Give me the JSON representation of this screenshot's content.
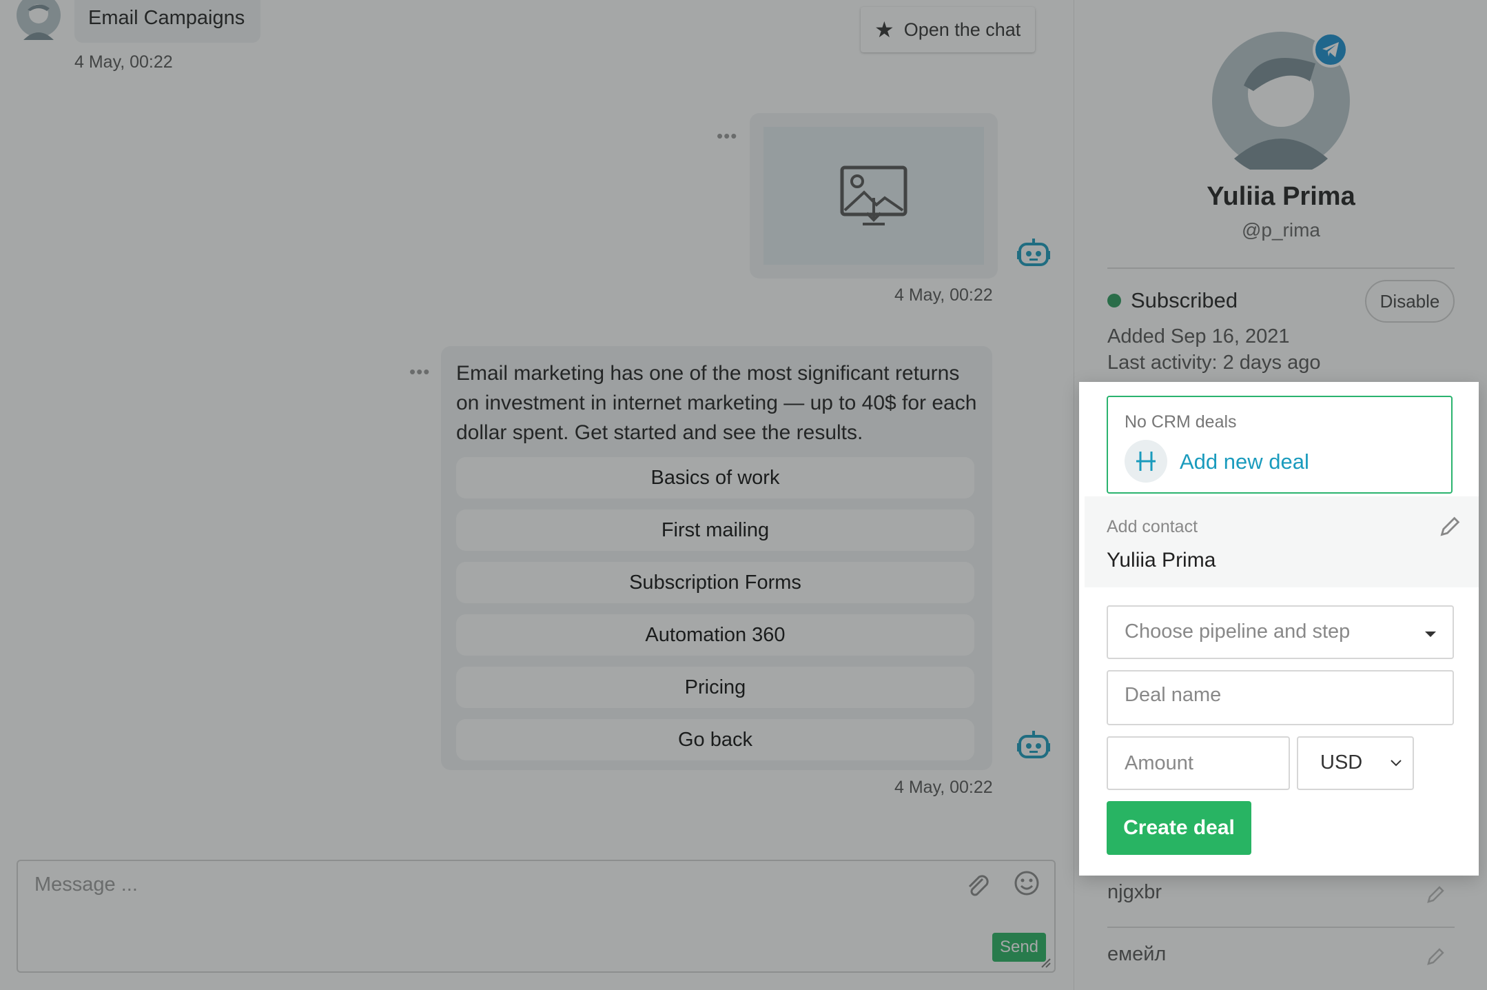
{
  "chat": {
    "campaign_name": "Email Campaigns",
    "open_chat_label": "Open the chat",
    "messages": [
      {
        "timestamp_top": "4 May, 00:22"
      },
      {
        "timestamp": "4 May, 00:22"
      },
      {
        "text": "Email marketing has one of the most significant returns on investment in internet marketing — up to 40$ for each dollar spent. Get started and see the results.",
        "buttons": [
          "Basics of work",
          "First mailing",
          "Subscription Forms",
          "Automation 360",
          "Pricing",
          "Go back"
        ],
        "timestamp": "4 May, 00:22"
      }
    ],
    "composer": {
      "placeholder": "Message ...",
      "send_label": "Send"
    }
  },
  "profile": {
    "name": "Yuliia Prima",
    "handle": "@p_rima",
    "status": "Subscribed",
    "disable_label": "Disable",
    "added": "Added Sep 16, 2021",
    "last_activity": "Last activity: 2 days ago",
    "fields": [
      "njgxbr",
      "емейл"
    ]
  },
  "deal_form": {
    "no_deals": "No CRM deals",
    "add_deal_label": "Add new deal",
    "contact_label": "Add contact",
    "contact_name": "Yuliia Prima",
    "pipeline_placeholder": "Choose pipeline and step",
    "deal_name_placeholder": "Deal name",
    "amount_placeholder": "Amount",
    "currency": "USD",
    "create_label": "Create deal"
  },
  "colors": {
    "accent_green": "#28b463",
    "link_teal": "#1a9bbd",
    "telegram_blue": "#1b8fd1",
    "status_green": "#2c9c5e"
  },
  "icons": [
    "avatar-icon",
    "star-icon",
    "image-download-icon",
    "bot-icon",
    "paperclip-icon",
    "smile-icon",
    "telegram-icon",
    "plus-icon",
    "pencil-icon",
    "caret-down-icon",
    "chevron-down-icon"
  ]
}
